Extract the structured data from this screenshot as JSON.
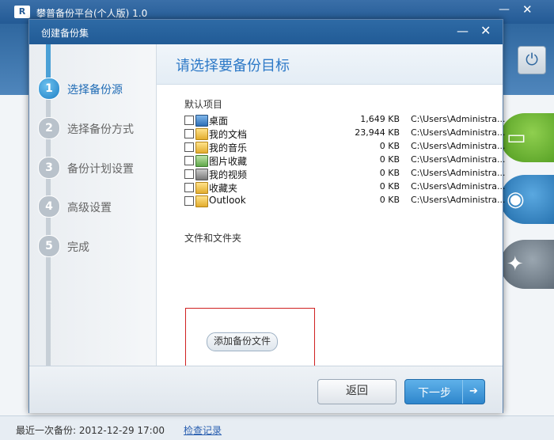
{
  "app": {
    "title": "攀普备份平台(个人版) 1.0",
    "logo": "R",
    "minimize_icon": "—",
    "close_icon": "✕",
    "power_icon": "⏻"
  },
  "status_bar": {
    "last_backup_text": "最近一次备份:  2012-12-29 17:00",
    "check_log_link": "检查记录"
  },
  "dialog": {
    "title": "创建备份集",
    "minimize_icon": "—",
    "close_icon": "✕",
    "steps": [
      {
        "number": "1",
        "label": "选择备份源",
        "active": true
      },
      {
        "number": "2",
        "label": "选择备份方式",
        "active": false
      },
      {
        "number": "3",
        "label": "备份计划设置",
        "active": false
      },
      {
        "number": "4",
        "label": "高级设置",
        "active": false
      },
      {
        "number": "5",
        "label": "完成",
        "active": false
      }
    ],
    "content_title": "请选择要备份目标",
    "default_items_label": "默认项目",
    "files": [
      {
        "name": "桌面",
        "size": "1,649 KB",
        "path": "C:\\Users\\Administra...",
        "icon": "desktop-icon"
      },
      {
        "name": "我的文档",
        "size": "23,944 KB",
        "path": "C:\\Users\\Administra...",
        "icon": "documents-folder-icon"
      },
      {
        "name": "我的音乐",
        "size": "0 KB",
        "path": "C:\\Users\\Administra...",
        "icon": "music-folder-icon"
      },
      {
        "name": "图片收藏",
        "size": "0 KB",
        "path": "C:\\Users\\Administra...",
        "icon": "pictures-folder-icon"
      },
      {
        "name": "我的视频",
        "size": "0 KB",
        "path": "C:\\Users\\Administra...",
        "icon": "video-folder-icon"
      },
      {
        "name": "收藏夹",
        "size": "0 KB",
        "path": "C:\\Users\\Administra...",
        "icon": "favorites-folder-icon"
      },
      {
        "name": "Outlook",
        "size": "0 KB",
        "path": "C:\\Users\\Administra...",
        "icon": "outlook-folder-icon"
      }
    ],
    "files_folders_label": "文件和文件夹",
    "add_backup_file_button": "添加备份文件",
    "back_button": "返回",
    "next_button": "下一步",
    "next_arrow_icon": "➔"
  }
}
